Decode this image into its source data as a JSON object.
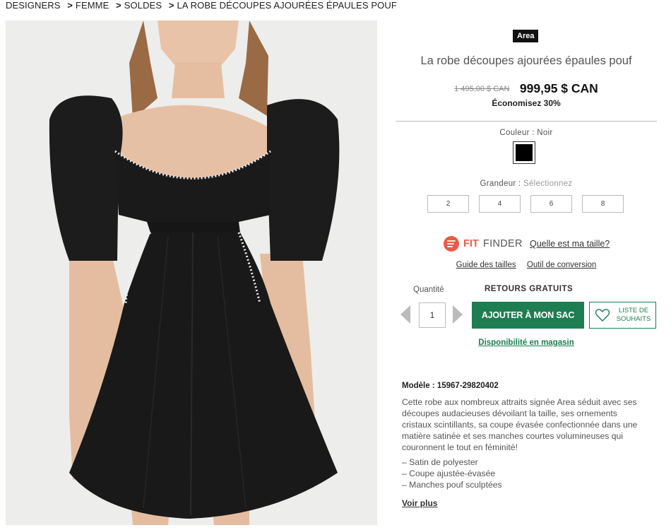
{
  "breadcrumb": {
    "items": [
      "DESIGNERS",
      "FEMME",
      "SOLDES",
      "LA ROBE DÉCOUPES AJOURÉES ÉPAULES POUF"
    ],
    "separator": ">"
  },
  "product": {
    "brand": "Area",
    "title": "La robe découpes ajourées épaules pouf",
    "old_price": "1 495,00 $ CAN",
    "price": "999,95 $ CAN",
    "savings": "Économisez 30%",
    "color_label": "Couleur : Noir",
    "color_swatch": "#000000",
    "size_label": "Grandeur :",
    "size_placeholder": "Sélectionnez",
    "sizes": [
      "2",
      "4",
      "6",
      "8"
    ],
    "fit_finder": {
      "fit": "FIT",
      "finder": "FINDER",
      "link": "Quelle est ma taille?"
    },
    "size_guide_link": "Guide des tailles",
    "conversion_link": "Outil de conversion",
    "quantity_label": "Quantité",
    "quantity": "1",
    "free_returns": "RETOURS GRATUITS",
    "add_to_bag": "AJOUTER À MON SAC",
    "wishlist": "LISTE DE SOUHAITS",
    "store_availability": "Disponibilité en magasin",
    "model_label": "Modèle : 15967-29820402",
    "description": "Cette robe aux nombreux attraits signée Area séduit avec ses découpes audacieuses dévoilant la taille, ses ornements cristaux scintillants, sa coupe évasée confectionnée dans une matière satinée et ses manches courtes volumineuses qui couronnent le tout en féminité!",
    "features": [
      "Satin de polyester",
      "Coupe ajustée-évasée",
      "Manches pouf sculptées"
    ],
    "see_more": "Voir plus"
  },
  "colors": {
    "accent": "#1e7e52",
    "fit_finder": "#ea5a4a",
    "badge_bg": "#111111"
  }
}
